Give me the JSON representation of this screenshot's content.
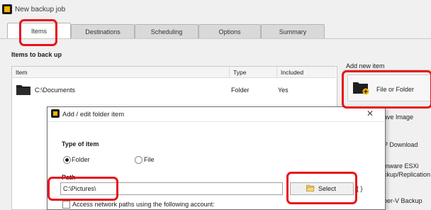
{
  "window": {
    "title": "New backup job"
  },
  "tabs": [
    {
      "label": "Items"
    },
    {
      "label": "Destinations"
    },
    {
      "label": "Scheduling"
    },
    {
      "label": "Options"
    },
    {
      "label": "Summary"
    }
  ],
  "items_section": {
    "title": "Items to back up",
    "columns": [
      "Item",
      "Type",
      "Included"
    ],
    "rows": [
      {
        "item": "C:\\Documents",
        "type": "Folder",
        "included": "Yes"
      }
    ]
  },
  "right_panel": {
    "title": "Add new item",
    "add_button_label": "File or Folder",
    "items": [
      "ave Image",
      "P Download",
      "mware ESXi",
      "ackup/Replication",
      "per-V Backup"
    ]
  },
  "dialog": {
    "title": "Add / edit folder item",
    "type_label": "Type of item",
    "option_folder": "Folder",
    "option_file": "File",
    "path_label": "Path",
    "path_value": "C:\\Pictures\\",
    "select_label": "Select",
    "braces": "{ }",
    "network_checkbox_label": "Access network paths using the following account:"
  },
  "colors": {
    "highlight": "#e8121c",
    "accent": "#f5b400"
  }
}
